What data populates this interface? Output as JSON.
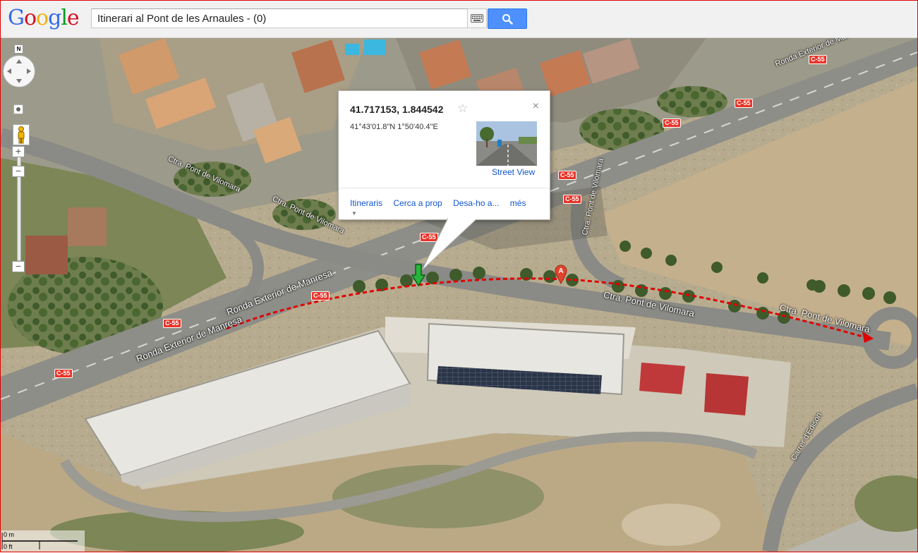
{
  "app": {
    "logo_letters": [
      {
        "ch": "G",
        "color": "#3369e8"
      },
      {
        "ch": "o",
        "color": "#d50f25"
      },
      {
        "ch": "o",
        "color": "#eeb211"
      },
      {
        "ch": "g",
        "color": "#3369e8"
      },
      {
        "ch": "l",
        "color": "#009925"
      },
      {
        "ch": "e",
        "color": "#d50f25"
      }
    ]
  },
  "search": {
    "value": "Itinerari al Pont de les Arnaules - (0)",
    "button_icon": "search-icon",
    "keyboard_icon": "keyboard-icon"
  },
  "map_controls": {
    "north_label": "N",
    "zoom_in": "+",
    "zoom_out": "−"
  },
  "roads": {
    "pont_vilomara_1": "Ctra. Pont de Vilomara",
    "pont_vilomara_2": "Ctra. Pont de Vilomara",
    "pont_vilomara_3": "Ctra. Pont de Vilomara",
    "pont_vilomara_4": "Ctra. Pont de Vilomara",
    "pont_vilomara_5": "Ctra. Pont de Vilomara",
    "ronda_1": "Ronda Exterior de Manresa",
    "ronda_2": "Ronda Exterior de Manresa",
    "ronda_top": "Ronda Exterior de Manresa",
    "carrer_edison": "Carrer d'Edison",
    "highway_badge": "C-55"
  },
  "marker": {
    "label": "A",
    "color": "#e2432c"
  },
  "route": {
    "color": "#e00000"
  },
  "info_window": {
    "coordinates": "41.717153, 1.844542",
    "dms": "41°43'01.8\"N 1°50'40.4\"E",
    "street_view_label": "Street View",
    "star_icon": "☆",
    "close_icon": "×",
    "links": [
      "Itineraris",
      "Cerca a prop",
      "Desa-ho a...",
      "més"
    ]
  },
  "scale": {
    "label_0m": "0 m",
    "label_0ft": "0 ft"
  }
}
